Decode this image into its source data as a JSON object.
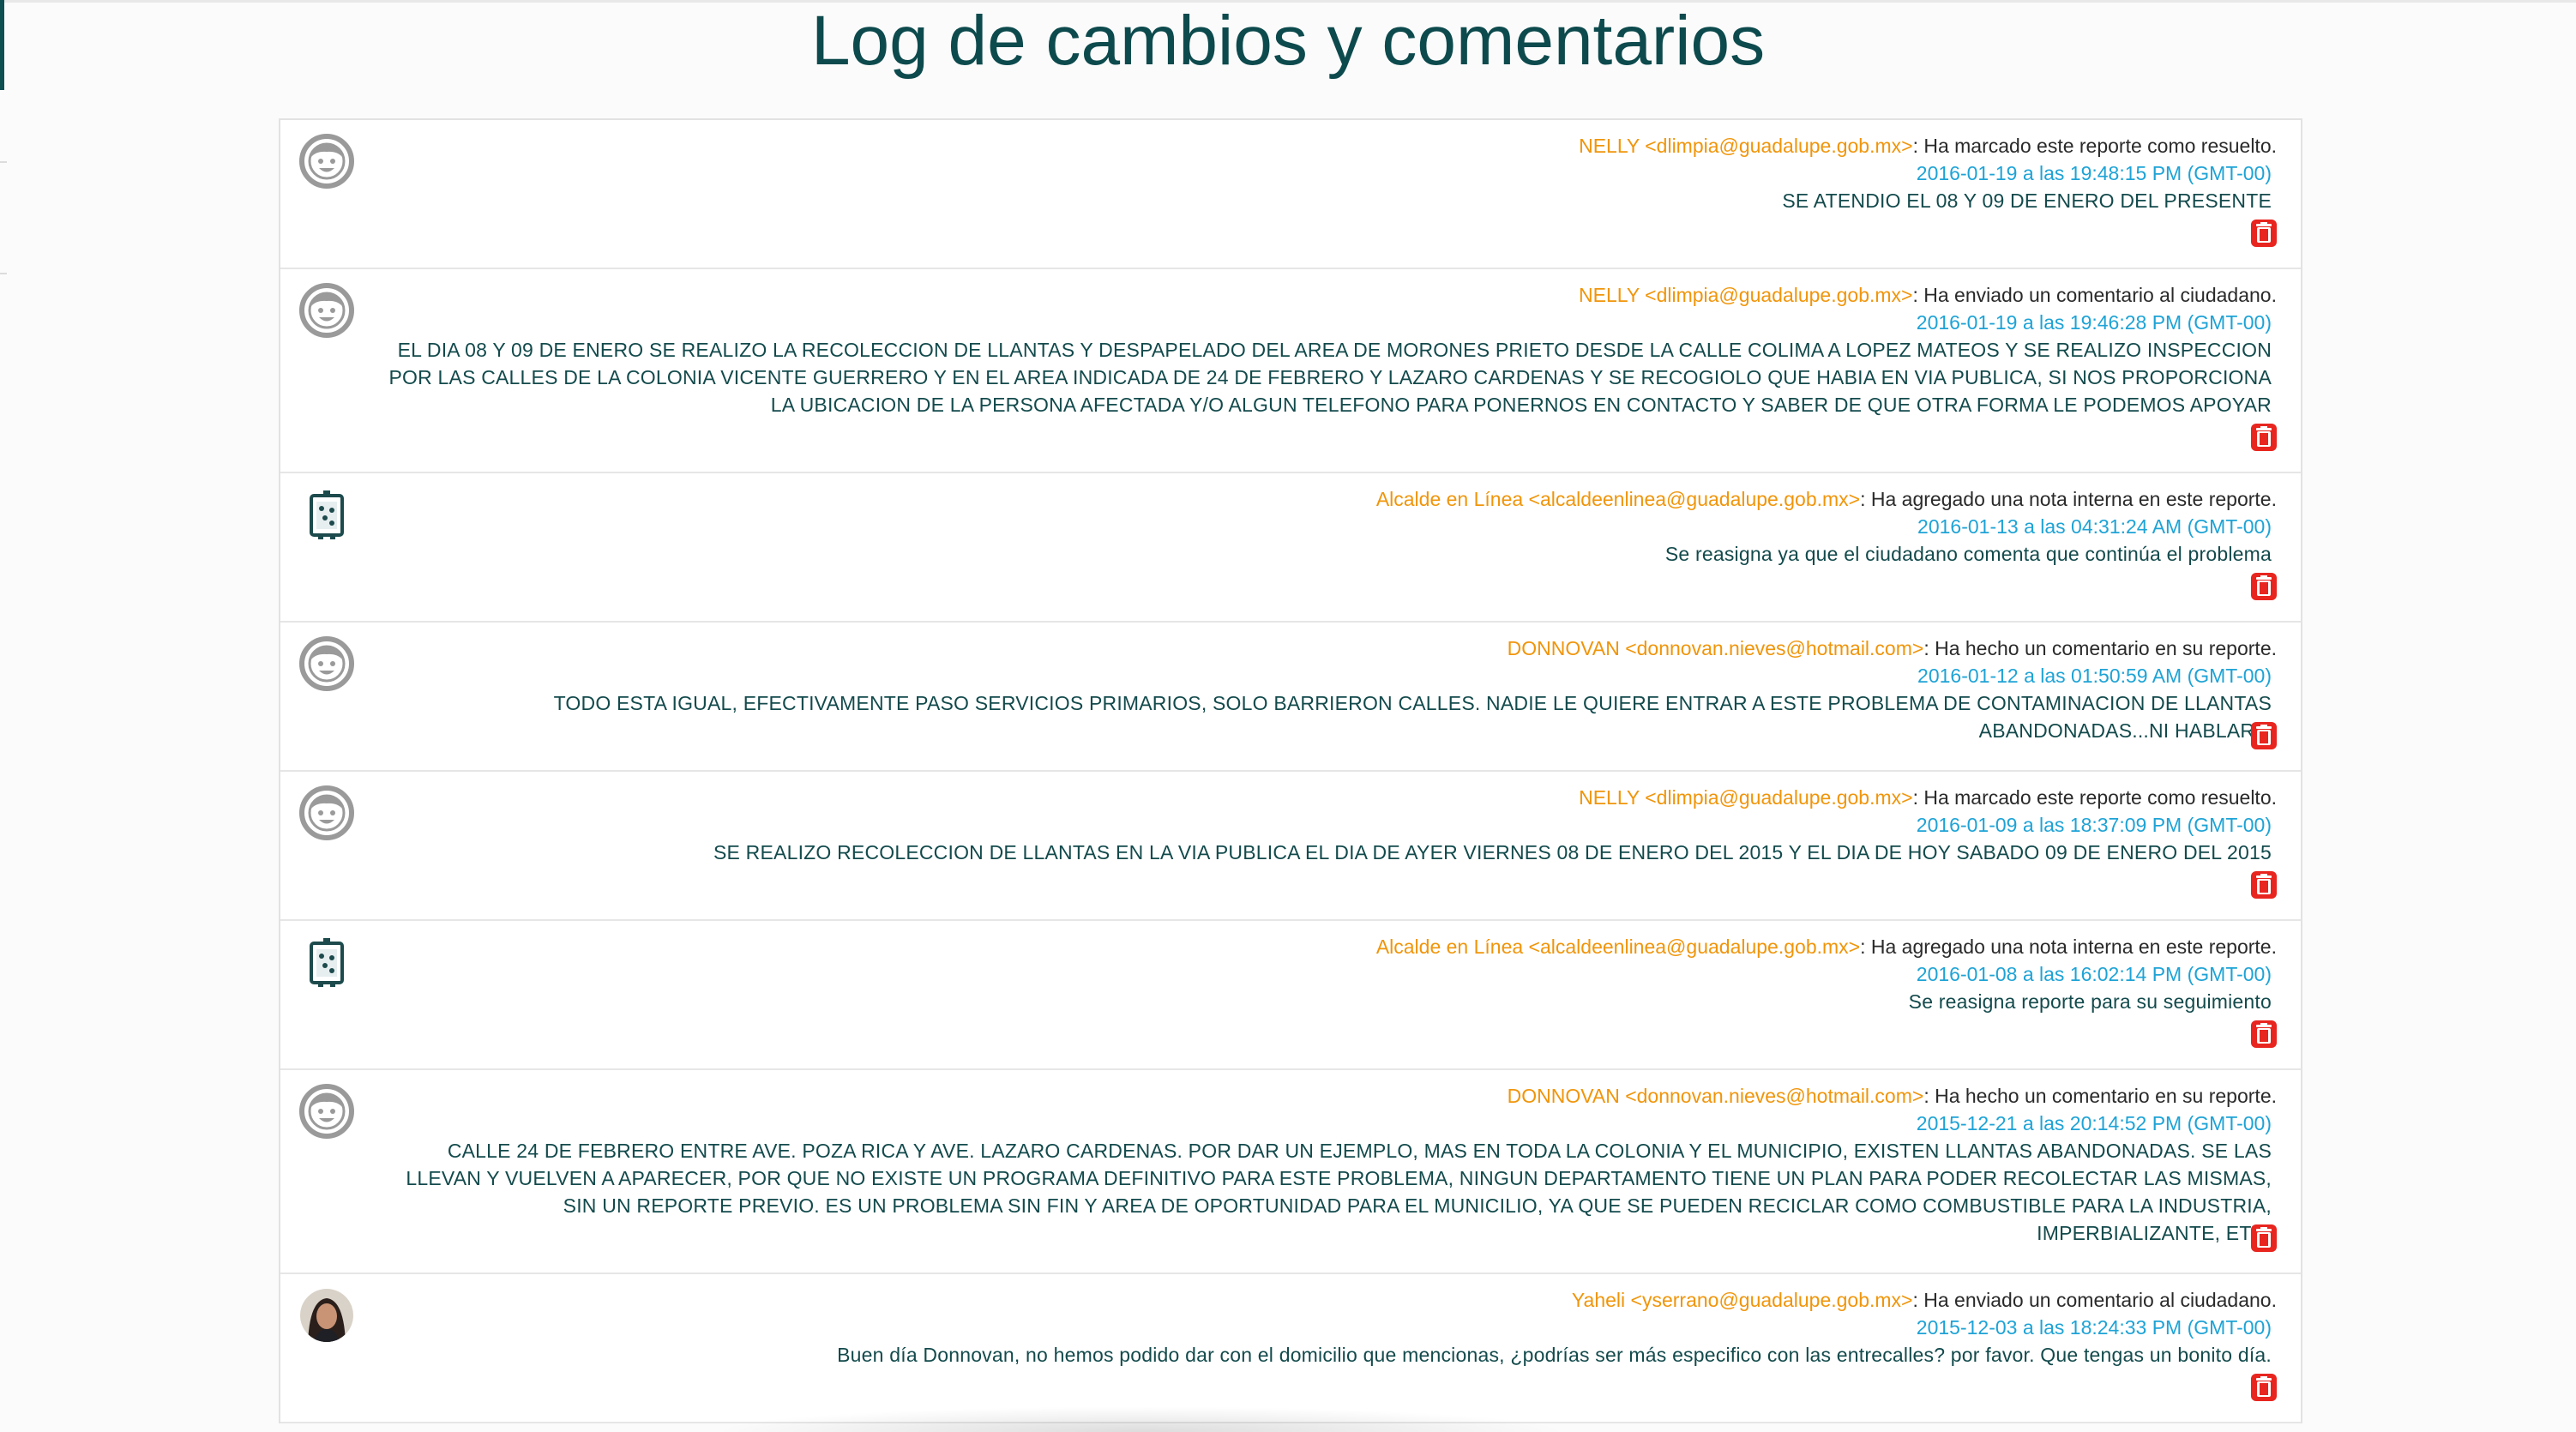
{
  "page": {
    "title": "Log de cambios y comentarios"
  },
  "colors": {
    "title": "#0d4a4d",
    "author": "#f0950a",
    "timestamp": "#1ea3d6",
    "message": "#134a4c",
    "delete": "#e8251f"
  },
  "entries": [
    {
      "avatar": "smiley-avatar-icon",
      "author": "NELLY <dlimpia@guadalupe.gob.mx>",
      "action": ": Ha marcado este reporte como resuelto.",
      "timestamp": "2016-01-19 a las 19:48:15 PM (GMT-00)",
      "message": "SE ATENDIO EL 08 Y 09 DE ENERO DEL PRESENTE"
    },
    {
      "avatar": "smiley-avatar-icon",
      "author": "NELLY <dlimpia@guadalupe.gob.mx>",
      "action": ": Ha enviado un comentario al ciudadano.",
      "timestamp": "2016-01-19 a las 19:46:28 PM (GMT-00)",
      "message": "EL DIA 08 Y 09 DE ENERO SE REALIZO LA RECOLECCION DE LLANTAS Y DESPAPELADO DEL AREA DE MORONES PRIETO DESDE LA CALLE COLIMA A LOPEZ MATEOS Y SE REALIZO INSPECCION POR LAS CALLES DE LA COLONIA VICENTE GUERRERO Y EN EL AREA INDICADA DE 24 DE FEBRERO Y LAZARO CARDENAS Y SE RECOGIOLO QUE HABIA EN VIA PUBLICA, SI NOS PROPORCIONA LA UBICACION DE LA PERSONA AFECTADA Y/O ALGUN TELEFONO PARA PONERNOS EN CONTACTO Y SABER DE QUE OTRA FORMA LE PODEMOS APOYAR"
    },
    {
      "avatar": "municipal-logo-icon",
      "author": "Alcalde en Línea <alcaldeenlinea@guadalupe.gob.mx>",
      "action": ": Ha agregado una nota interna en este reporte.",
      "timestamp": "2016-01-13 a las 04:31:24 AM (GMT-00)",
      "message": "Se reasigna ya que el ciudadano comenta que continúa el problema"
    },
    {
      "avatar": "smiley-avatar-icon",
      "author": "DONNOVAN <donnovan.nieves@hotmail.com>",
      "action": ": Ha hecho un comentario en su reporte.",
      "timestamp": "2016-01-12 a las 01:50:59 AM (GMT-00)",
      "message": "TODO ESTA IGUAL, EFECTIVAMENTE PASO SERVICIOS PRIMARIOS, SOLO BARRIERON CALLES. NADIE LE QUIERE ENTRAR A ESTE PROBLEMA DE CONTAMINACION DE LLANTAS ABANDONADAS...NI HABLAR..."
    },
    {
      "avatar": "smiley-avatar-icon",
      "author": "NELLY <dlimpia@guadalupe.gob.mx>",
      "action": ": Ha marcado este reporte como resuelto.",
      "timestamp": "2016-01-09 a las 18:37:09 PM (GMT-00)",
      "message": "SE REALIZO RECOLECCION DE LLANTAS EN LA VIA PUBLICA EL DIA DE AYER VIERNES 08 DE ENERO DEL 2015 Y EL DIA DE HOY SABADO 09 DE ENERO DEL 2015"
    },
    {
      "avatar": "municipal-logo-icon",
      "author": "Alcalde en Línea <alcaldeenlinea@guadalupe.gob.mx>",
      "action": ": Ha agregado una nota interna en este reporte.",
      "timestamp": "2016-01-08 a las 16:02:14 PM (GMT-00)",
      "message": "Se reasigna reporte para su seguimiento"
    },
    {
      "avatar": "smiley-avatar-icon",
      "author": "DONNOVAN <donnovan.nieves@hotmail.com>",
      "action": ": Ha hecho un comentario en su reporte.",
      "timestamp": "2015-12-21 a las 20:14:52 PM (GMT-00)",
      "message": "CALLE 24 DE FEBRERO ENTRE AVE. POZA RICA Y AVE. LAZARO CARDENAS. POR DAR UN EJEMPLO, MAS EN TODA LA COLONIA Y EL MUNICIPIO, EXISTEN LLANTAS ABANDONADAS. SE LAS LLEVAN Y VUELVEN A APARECER, POR QUE NO EXISTE UN PROGRAMA DEFINITIVO PARA ESTE PROBLEMA, NINGUN DEPARTAMENTO TIENE UN PLAN PARA PODER RECOLECTAR LAS MISMAS, SIN UN REPORTE PREVIO. ES UN PROBLEMA SIN FIN Y AREA DE OPORTUNIDAD PARA EL MUNICILIO, YA QUE SE PUEDEN RECICLAR COMO COMBUSTIBLE PARA LA INDUSTRIA, IMPERBIALIZANTE, ETC."
    },
    {
      "avatar": "user-photo-avatar",
      "author": "Yaheli <yserrano@guadalupe.gob.mx>",
      "action": ": Ha enviado un comentario al ciudadano.",
      "timestamp": "2015-12-03 a las 18:24:33 PM (GMT-00)",
      "message": "Buen día Donnovan, no hemos podido dar con el domicilio que mencionas, ¿podrías ser más especifico con las entrecalles? por favor. Que tengas un bonito día."
    }
  ]
}
